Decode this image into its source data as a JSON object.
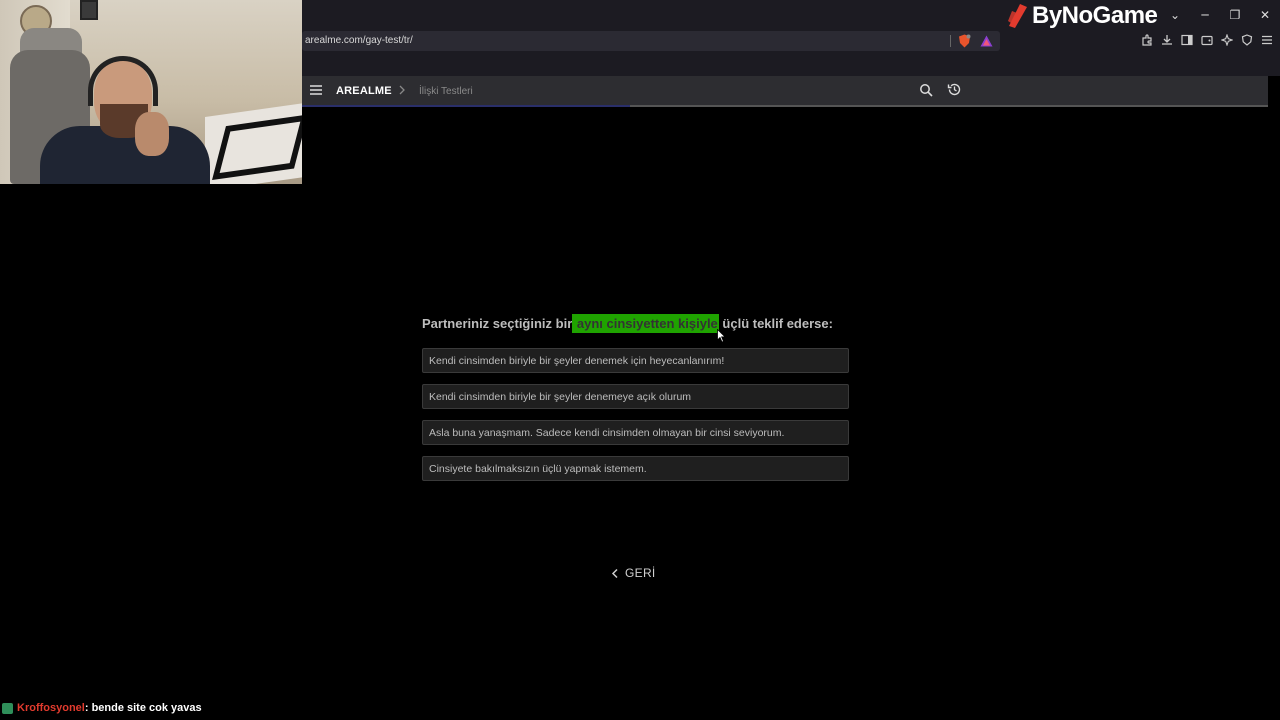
{
  "browser": {
    "url": "arealme.com/gay-test/tr/",
    "brand": "ByNoGame"
  },
  "site": {
    "logo": "AREALME",
    "breadcrumb": "İlişki Testleri",
    "progress": 0.34
  },
  "quiz": {
    "question_before": "Partneriniz seçtiğiniz bir",
    "question_highlight": " aynı cinsiyetten kişiyle",
    "question_after": " üçlü teklif ederse:",
    "highlight_color": "#1fa300",
    "options": [
      "Kendi cinsimden biriyle bir şeyler denemek için heyecanlanırım!",
      "Kendi cinsimden biriyle bir şeyler denemeye açık olurum",
      "Asla buna yanaşmam. Sadece kendi cinsimden olmayan bir cinsi seviyorum.",
      "Cinsiyete bakılmaksızın üçlü yapmak istemem."
    ],
    "back_label": "GERİ"
  },
  "chat": {
    "user": "Kroffosyonel",
    "message": " : bende site cok yavas",
    "user_color": "#e23b2e"
  }
}
